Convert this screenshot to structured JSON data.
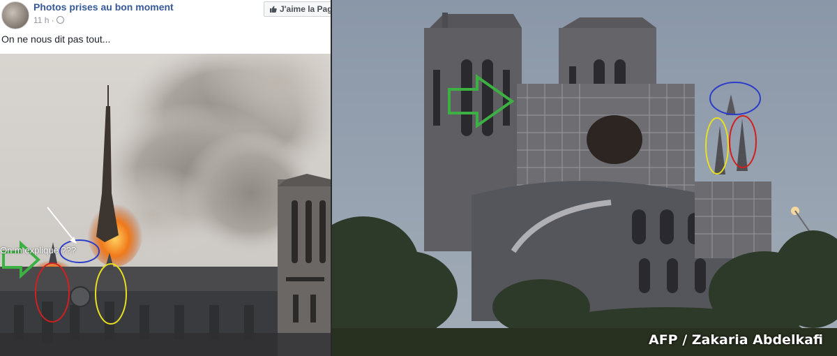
{
  "post": {
    "page_name": "Photos prises au bon moment",
    "time": "11 h ·",
    "like_button": "J'aime la Page",
    "text": "On ne nous dit pas tout..."
  },
  "left_photo": {
    "overlay_text": "On m explique ???"
  },
  "right_photo": {
    "credit": "AFP / Zakaria Abdelkafi"
  },
  "colors": {
    "facebook_link": "#365899",
    "annotation_green": "#3cb043",
    "annotation_blue": "#2a3cc8",
    "annotation_red": "#d02020",
    "annotation_yellow": "#e8e020"
  }
}
